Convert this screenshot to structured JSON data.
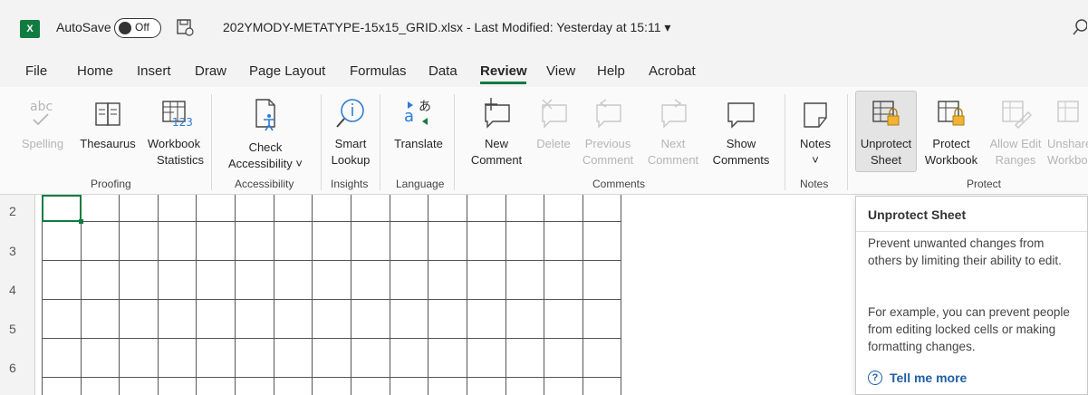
{
  "titlebar": {
    "app_icon": "X",
    "autosave_label": "AutoSave",
    "autosave_state": "Off",
    "document_title": "202YMODY-METATYPE-15x15_GRID.xlsx  -  Last Modified: Yesterday at 15:11  ▾"
  },
  "tabs": [
    "File",
    "Home",
    "Insert",
    "Draw",
    "Page Layout",
    "Formulas",
    "Data",
    "Review",
    "View",
    "Help",
    "Acrobat"
  ],
  "active_tab": "Review",
  "ribbon": {
    "spelling": [
      "Spelling",
      ""
    ],
    "thesaurus": [
      "Thesaurus",
      ""
    ],
    "workbook_statistics": [
      "Workbook",
      "Statistics"
    ],
    "check_accessibility": [
      "Check",
      "Accessibility ˅"
    ],
    "smart_lookup": [
      "Smart",
      "Lookup"
    ],
    "translate": [
      "Translate",
      ""
    ],
    "new_comment": [
      "New",
      "Comment"
    ],
    "delete": [
      "Delete",
      ""
    ],
    "previous_comment": [
      "Previous",
      "Comment"
    ],
    "next_comment": [
      "Next",
      "Comment"
    ],
    "show_comments": [
      "Show",
      "Comments"
    ],
    "notes": [
      "Notes",
      "˅"
    ],
    "unprotect_sheet": [
      "Unprotect",
      "Sheet"
    ],
    "protect_workbook": [
      "Protect",
      "Workbook"
    ],
    "allow_edit_ranges": [
      "Allow Edit",
      "Ranges"
    ],
    "unshare_workbook": [
      "Unshare",
      "Workbook"
    ],
    "groups": {
      "proofing": "Proofing",
      "accessibility": "Accessibility",
      "insights": "Insights",
      "language": "Language",
      "comments": "Comments",
      "notes": "Notes",
      "protect": "Protect"
    }
  },
  "rows": [
    "2",
    "3",
    "4",
    "5",
    "6"
  ],
  "tooltip": {
    "title": "Unprotect Sheet",
    "p1": "Prevent unwanted changes from others by limiting their ability to edit.",
    "p2": "For example, you can prevent people from editing locked cells or making formatting changes.",
    "link": "Tell me more",
    "help_glyph": "?"
  },
  "colors": {
    "accent": "#107c41",
    "link": "#1f5fa5"
  }
}
